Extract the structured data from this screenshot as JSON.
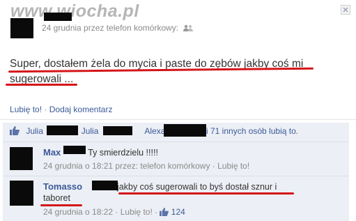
{
  "watermark": "www.wiocha.pl",
  "post": {
    "meta_date": "24 grudnia przez",
    "meta_device": "telefon komórkowy:",
    "status_line1": "Super, dostałem żela do mycia i paste do zębów jakby coś mi",
    "status_line2": "sugerowali ...",
    "like_link": "Lubię to!",
    "dot": "·",
    "comment_link": "Dodaj komentarz"
  },
  "likes": {
    "name1": "Julia",
    "name2": "Julia",
    "name3": "Alexa",
    "suffix": "i 71 innych osób lubią to."
  },
  "comments": [
    {
      "author": "Max",
      "text": "Ty smierdzielu !!!!!",
      "meta": "24 grudnia o 18:21 przez: telefon komórkowy · Lubię to!"
    },
    {
      "author": "Tomasso",
      "text_line1": "jakby coś sugerowali to byś dostał sznur i",
      "text_line2": "taboret",
      "meta": "24 grudnia o 18:22 · Lubię to! · ",
      "like_count": "124"
    }
  ],
  "colors": {
    "link": "#3b5998",
    "underline": "#d4161a",
    "comment_bg": "#eceff5"
  },
  "icons": {
    "privacy": "people-icon",
    "like": "thumbs-up-icon",
    "close": "close-icon"
  }
}
